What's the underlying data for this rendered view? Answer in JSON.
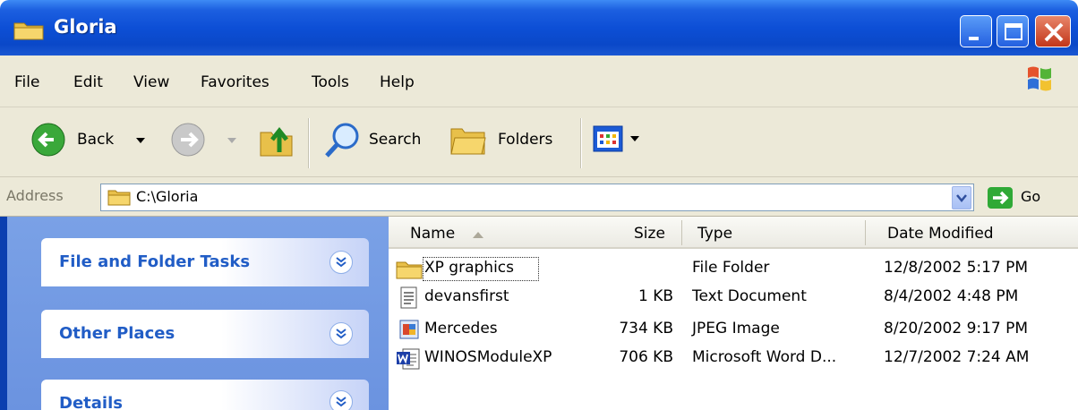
{
  "window": {
    "title": "Gloria"
  },
  "menu": {
    "items": [
      "File",
      "Edit",
      "View",
      "Favorites",
      "Tools",
      "Help"
    ]
  },
  "toolbar": {
    "back_label": "Back",
    "search_label": "Search",
    "folders_label": "Folders"
  },
  "address": {
    "label": "Address",
    "value": "C:\\Gloria",
    "go_label": "Go"
  },
  "tasks": {
    "file_folder": "File and Folder Tasks",
    "other_places": "Other Places",
    "details": "Details"
  },
  "columns": {
    "name": "Name",
    "size": "Size",
    "type": "Type",
    "date": "Date Modified"
  },
  "files": [
    {
      "name": "XP graphics",
      "size": "",
      "type": "File Folder",
      "date": "12/8/2002 5:17 PM",
      "icon": "folder-icon"
    },
    {
      "name": "devansfirst",
      "size": "1 KB",
      "type": "Text Document",
      "date": "8/4/2002 4:48 PM",
      "icon": "text-document-icon"
    },
    {
      "name": "Mercedes",
      "size": "734 KB",
      "type": "JPEG Image",
      "date": "8/20/2002 9:17 PM",
      "icon": "jpeg-image-icon"
    },
    {
      "name": "WINOSModuleXP",
      "size": "706 KB",
      "type": "Microsoft Word D...",
      "date": "12/7/2002 7:24 AM",
      "icon": "word-document-icon"
    }
  ]
}
